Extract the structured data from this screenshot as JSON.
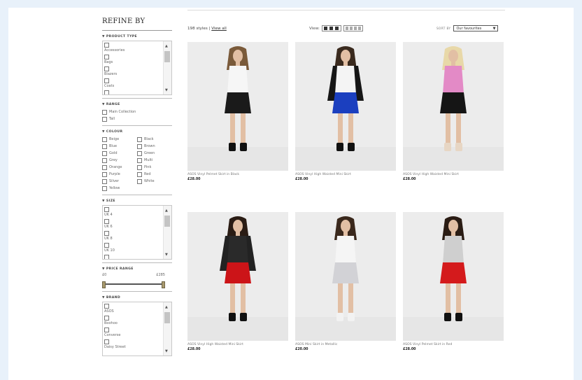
{
  "sidebar": {
    "title": "REFINE BY",
    "product_type": {
      "title": "PRODUCT TYPE",
      "items": [
        "Accessories",
        "Bags",
        "Blazers",
        "Coats"
      ]
    },
    "range": {
      "title": "RANGE",
      "items": [
        "Main Collection",
        "Tall"
      ]
    },
    "colour": {
      "title": "COLOUR",
      "left": [
        "Beige",
        "Blue",
        "Gold",
        "Grey",
        "Orange",
        "Purple",
        "Silver",
        "Yellow"
      ],
      "right": [
        "Black",
        "Brown",
        "Green",
        "Multi",
        "Pink",
        "Red",
        "White"
      ]
    },
    "size": {
      "title": "SIZE",
      "items": [
        "UK 4",
        "UK 6",
        "UK 8",
        "UK 10"
      ]
    },
    "price_range": {
      "title": "PRICE RANGE",
      "min": "£0",
      "max": "£285"
    },
    "brand": {
      "title": "BRAND",
      "items": [
        "ASOS",
        "Boohoo",
        "Converse",
        "Daisy Street"
      ]
    }
  },
  "toolbar": {
    "count": "198 styles",
    "separator": "|",
    "view_all": "View all",
    "view_label": "View:",
    "sort_label": "SORT BY",
    "sort_value": "Our favourites"
  },
  "products": [
    {
      "name": "ASOS Vinyl Pelmet Skirt in Black",
      "price": "£28.00",
      "top": "#f6f6f6",
      "skirt": "#1a1a1a",
      "jacket": "",
      "hair": "#7a5a3a",
      "shoes": "#111111"
    },
    {
      "name": "ASOS Vinyl High Waisted Mini Skirt",
      "price": "£28.00",
      "top": "#f4f4f4",
      "skirt": "#1b3fbf",
      "jacket": "#161616",
      "hair": "#3a2a1e",
      "shoes": "#111111"
    },
    {
      "name": "ASOS Vinyl High Waisted Mini Skirt",
      "price": "£28.00",
      "top": "#e38ac6",
      "skirt": "#151515",
      "jacket": "",
      "hair": "#e8d8a8",
      "shoes": "#e7d6c4"
    },
    {
      "name": "ASOS Vinyl High Waisted Mini Skirt",
      "price": "£28.00",
      "top": "#2a2a2a",
      "skirt": "#cc1418",
      "jacket": "#222222",
      "hair": "#2a1c14",
      "shoes": "#111111"
    },
    {
      "name": "ASOS Mini Skirt in Metallic",
      "price": "£20.00",
      "top": "#f5f5f5",
      "skirt": "#d2d2d6",
      "jacket": "",
      "hair": "#3a281c",
      "shoes": "#f2f2f2"
    },
    {
      "name": "ASOS Vinyl Pelmet Skirt in Red",
      "price": "£28.00",
      "top": "#cfcfcf",
      "skirt": "#d41a1c",
      "jacket": "",
      "hair": "#2a1c14",
      "shoes": "#111111"
    }
  ],
  "colors": {
    "page_bg": "#e8f1fa",
    "card_bg": "#ececec",
    "accent": "#222222"
  }
}
